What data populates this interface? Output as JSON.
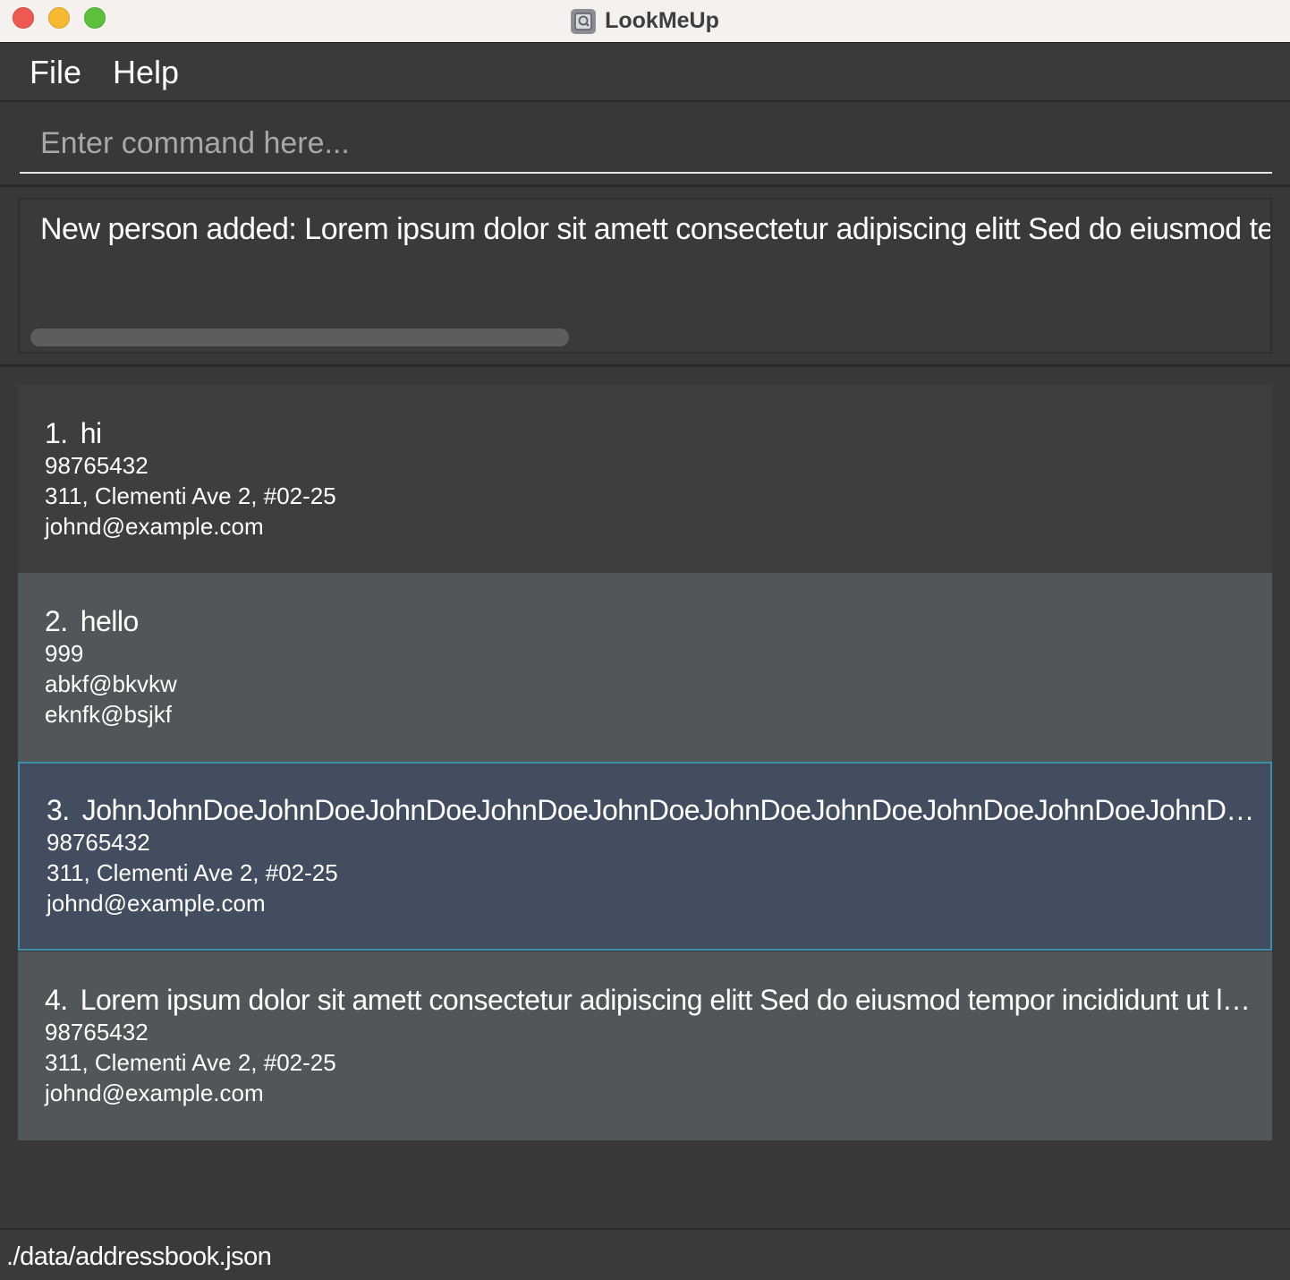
{
  "window": {
    "title": "LookMeUp"
  },
  "menu": {
    "file": "File",
    "help": "Help"
  },
  "command": {
    "placeholder": "Enter command here...",
    "value": ""
  },
  "result": {
    "text": "New person added: Lorem ipsum dolor sit amett consectetur adipiscing elitt Sed do eiusmod ter"
  },
  "persons": [
    {
      "index": "1.",
      "name": "hi",
      "phone": "98765432",
      "address": "311, Clementi Ave 2, #02-25",
      "email": "johnd@example.com"
    },
    {
      "index": "2.",
      "name": "hello",
      "phone": "999",
      "address": "abkf@bkvkw",
      "email": "eknfk@bsjkf"
    },
    {
      "index": "3.",
      "name": "JohnJohnDoeJohnDoeJohnDoeJohnDoeJohnDoeJohnDoeJohnDoeJohnDoeJohnDoeJohnDoe...",
      "phone": "98765432",
      "address": "311, Clementi Ave 2, #02-25",
      "email": "johnd@example.com",
      "selected": true
    },
    {
      "index": "4.",
      "name": "Lorem ipsum dolor sit amett consectetur adipiscing elitt Sed do eiusmod tempor incididunt ut lab...",
      "phone": "98765432",
      "address": "311, Clementi Ave 2, #02-25",
      "email": "johnd@example.com"
    }
  ],
  "status": {
    "path": "./data/addressbook.json"
  },
  "colors": {
    "background": "#383838",
    "card_odd": "#3c3e3f",
    "card_even": "#515658",
    "card_selected": "#424d5f",
    "selected_border": "#3b8fa9"
  }
}
